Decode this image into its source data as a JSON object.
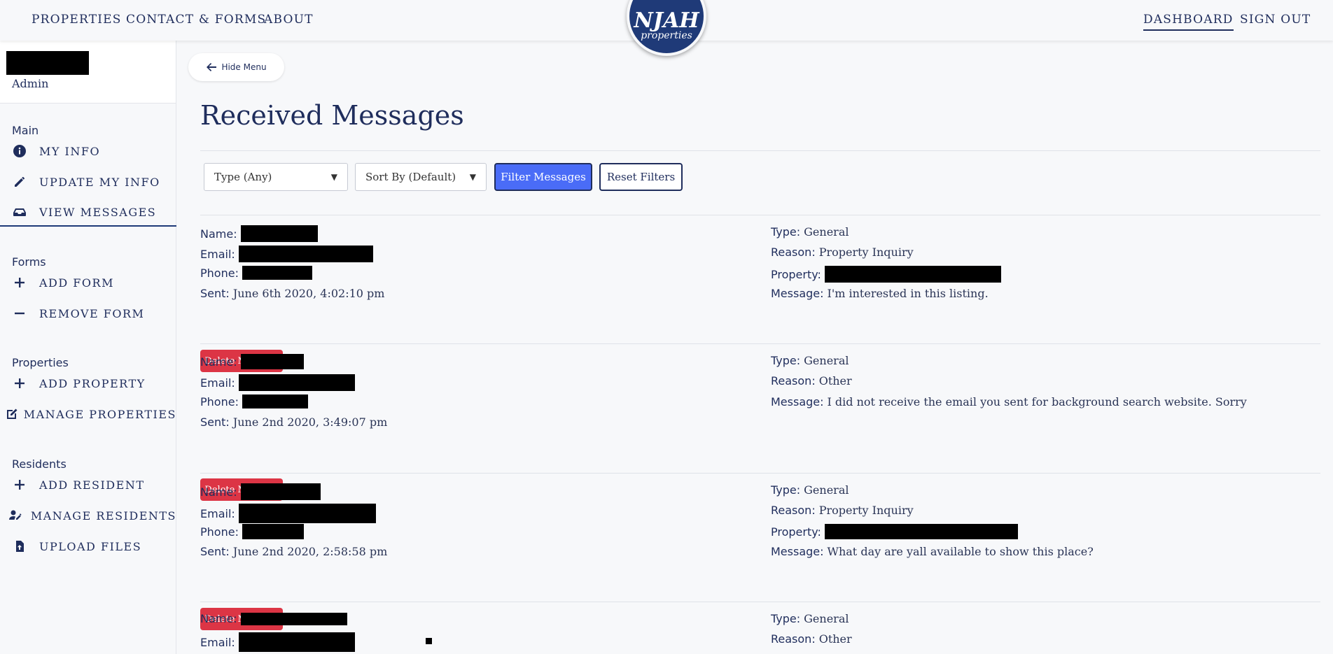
{
  "nav": {
    "left": [
      "PROPERTIES",
      "CONTACT & FORMS",
      "ABOUT"
    ],
    "right": [
      "DASHBOARD",
      "SIGN OUT"
    ],
    "logo_main": "NJAH",
    "logo_sub": "properties"
  },
  "sidebar": {
    "role": "Admin",
    "sections": {
      "main": "Main",
      "forms": "Forms",
      "properties": "Properties",
      "residents": "Residents"
    },
    "items": {
      "my_info": "MY INFO",
      "update_info": "UPDATE MY INFO",
      "view_messages": "VIEW MESSAGES",
      "add_form": "ADD FORM",
      "remove_form": "REMOVE FORM",
      "add_property": "ADD PROPERTY",
      "manage_properties": "MANAGE PROPERTIES",
      "add_resident": "ADD RESIDENT",
      "manage_residents": "MANAGE RESIDENTS",
      "upload_files": "UPLOAD FILES"
    }
  },
  "main": {
    "hide_menu": "Hide Menu",
    "title": "Received Messages",
    "type_select": "Type (Any)",
    "sort_select": "Sort By (Default)",
    "filter_button": "Filter Messages",
    "reset_button": "Reset Filters"
  },
  "labels": {
    "name": "Name:",
    "email": "Email:",
    "phone": "Phone:",
    "sent": "Sent:",
    "type": "Type:",
    "reason": "Reason:",
    "property": "Property:",
    "message": "Message:",
    "delete": "Delete Message"
  },
  "messages": [
    {
      "sent": "June 6th 2020, 4:02:10 pm",
      "type": "General",
      "reason": "Property Inquiry",
      "message": "I'm interested in this listing."
    },
    {
      "sent": "June 2nd 2020, 3:49:07 pm",
      "type": "General",
      "reason": "Other",
      "message": "I did not receive the email you sent for background search website. Sorry"
    },
    {
      "sent": "June 2nd 2020, 2:58:58 pm",
      "type": "General",
      "reason": "Property Inquiry",
      "message": "What day are yall available to show this place?"
    },
    {
      "type": "General",
      "reason": "Other"
    }
  ],
  "colors": {
    "navy": "#1f2d5c",
    "primary": "#4a6cf7",
    "danger": "#dc3545",
    "background": "#f7f8fa"
  },
  "icons": [
    "info-icon",
    "pencil-icon",
    "inbox-icon",
    "plus-icon",
    "minus-icon",
    "edit-square-icon",
    "user-edit-icon",
    "file-upload-icon",
    "arrow-left-icon"
  ]
}
